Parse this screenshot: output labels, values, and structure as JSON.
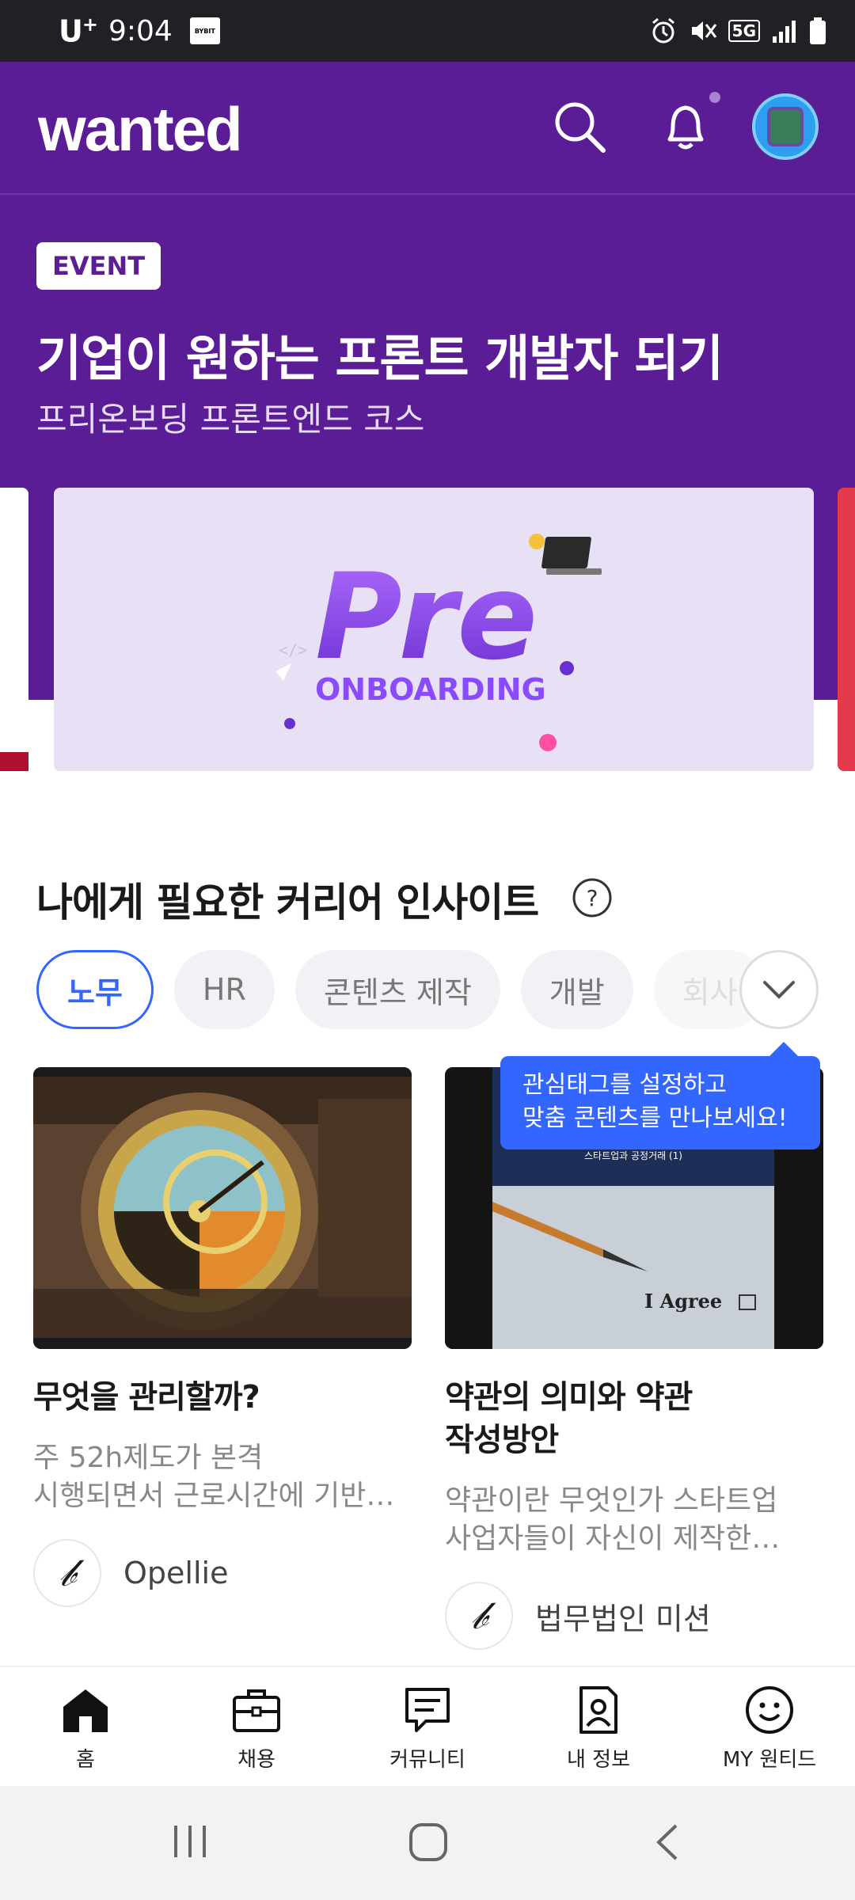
{
  "status": {
    "carrier": "U",
    "carrier_sup": "+",
    "time": "9:04",
    "app_icon": "BYBIT",
    "network": "5G"
  },
  "header": {
    "logo": "wanted"
  },
  "hero": {
    "badge": "EVENT",
    "title": "기업이 원하는 프론트 개발자 되기",
    "subtitle": "프리온보딩 프론트엔드 코스",
    "banner_line1": "Pre",
    "banner_line2": "ONBOARDING"
  },
  "insights": {
    "title": "나에게 필요한 커리어 인사이트",
    "chips": [
      "노무",
      "HR",
      "콘텐츠 제작",
      "개발",
      "회사"
    ],
    "tooltip_line1": "관심태그를 설정하고",
    "tooltip_line2": "맞춤 콘텐츠를 만나보세요!"
  },
  "cards": [
    {
      "title": "무엇을 관리할까?",
      "desc_line1": "주 52h제도가 본격",
      "desc_line2": "시행되면서 근로시간에 기반…",
      "author": "Opellie"
    },
    {
      "title_line1": "약관의 의미와 약관",
      "title_line2": "작성방안",
      "desc_line1": "약관이란 무엇인가  스타트업",
      "desc_line2": "사업자들이 자신이 제작한…",
      "author": "법무법인 미션",
      "thumb_header": "스타트업과 공정거래 (1)",
      "thumb_text": "I Agree"
    }
  ],
  "nav": [
    "홈",
    "채용",
    "커뮤니티",
    "내 정보",
    "MY 원티드"
  ],
  "colors": {
    "brand": "#5a1d96",
    "accent": "#3366ff"
  }
}
